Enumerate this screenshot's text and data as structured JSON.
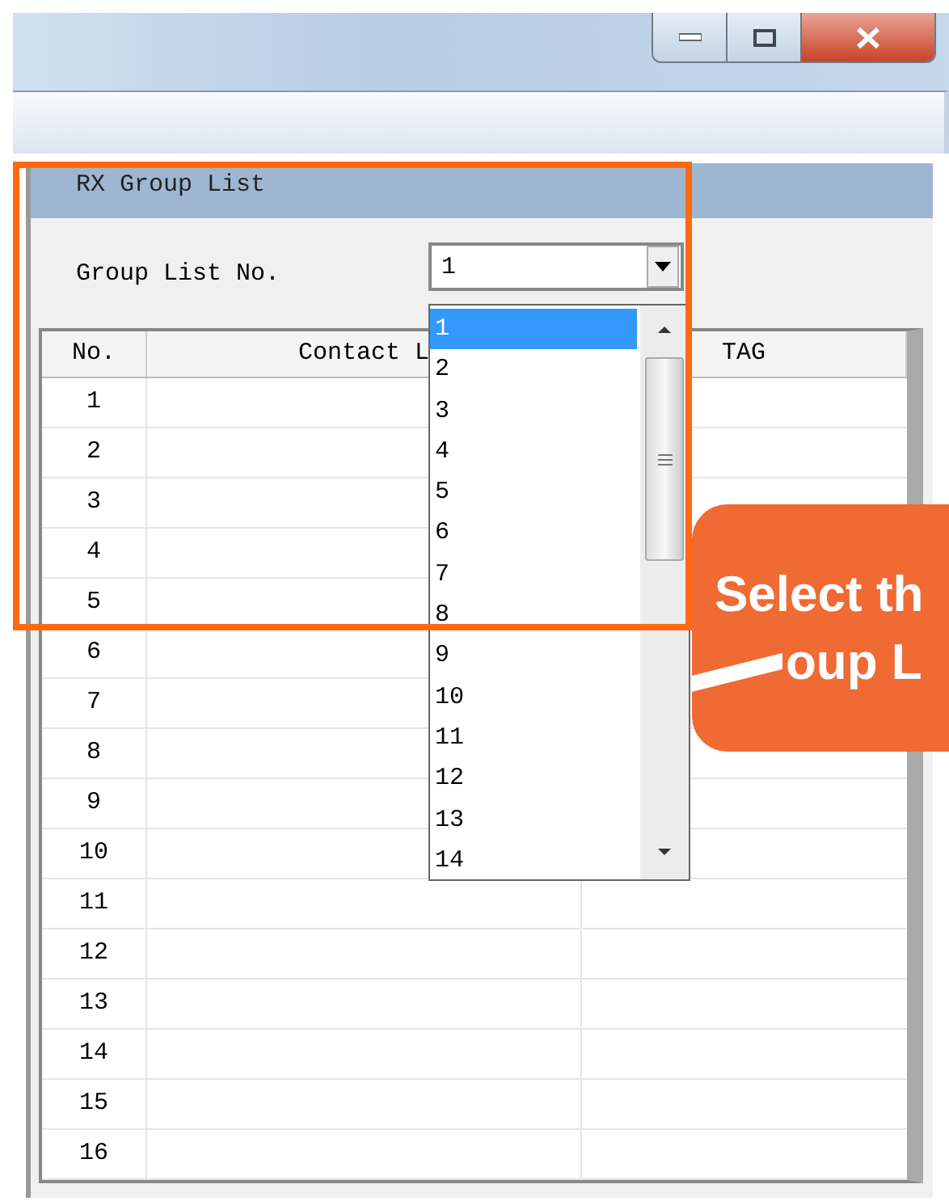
{
  "panel": {
    "title": "RX Group List"
  },
  "group_list": {
    "label": "Group List No.",
    "value": "1",
    "options": [
      {
        "label": "1",
        "selected": true
      },
      {
        "label": "2",
        "selected": false
      },
      {
        "label": "3",
        "selected": false
      },
      {
        "label": "4",
        "selected": false
      },
      {
        "label": "5",
        "selected": false
      },
      {
        "label": "6",
        "selected": false
      },
      {
        "label": "7",
        "selected": false
      },
      {
        "label": "8",
        "selected": false
      },
      {
        "label": "9",
        "selected": false
      },
      {
        "label": "10",
        "selected": false
      },
      {
        "label": "11",
        "selected": false
      },
      {
        "label": "12",
        "selected": false
      },
      {
        "label": "13",
        "selected": false
      },
      {
        "label": "14",
        "selected": false
      }
    ]
  },
  "table": {
    "columns": [
      "No.",
      "Contact L",
      "TAG"
    ],
    "rows": [
      "1",
      "2",
      "3",
      "4",
      "5",
      "6",
      "7",
      "8",
      "9",
      "10",
      "11",
      "12",
      "13",
      "14",
      "15",
      "16"
    ]
  },
  "callout": {
    "lines": [
      "Select th",
      "oup L"
    ]
  }
}
